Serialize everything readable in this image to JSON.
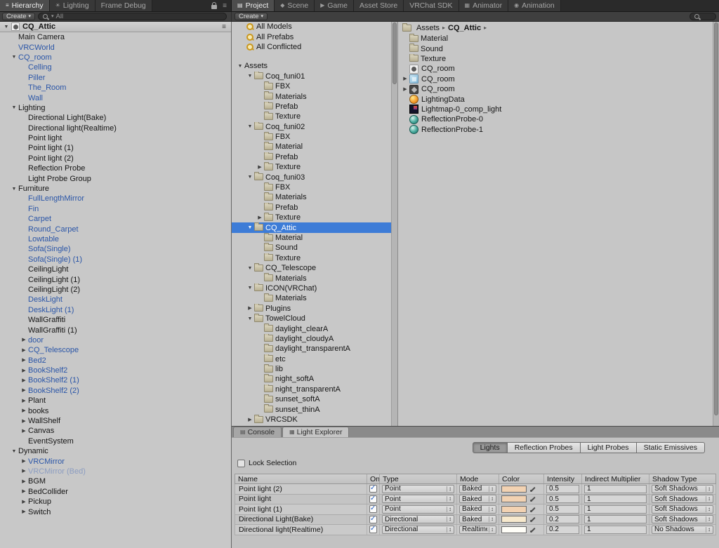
{
  "colors": {
    "selection_blue": "#3d7cd7",
    "prefab_text": "#2a55a7",
    "prefab_disabled_text": "#8b9cc0",
    "swatch_point": "#f2d2b2",
    "swatch_directional_baked": "#f7e9cd",
    "swatch_directional_realtime": "#fffef8"
  },
  "icons": {
    "expand_down": "▼",
    "expand_right": "▶",
    "dropdown_arrows": "↕",
    "breadcrumb_separator": "▸",
    "menu": "≡",
    "create_dropdown": "▾",
    "checkmark": "✓",
    "tab_glyphs": {
      "hierarchy": "≡",
      "lighting": "☀",
      "project": "▤",
      "scene": "◆",
      "game": "▶",
      "animator": "▦",
      "animation": "◉",
      "console": "▤",
      "light-explorer": "▦"
    }
  },
  "top_tabs": {
    "left": [
      {
        "label": "Hierarchy",
        "icon": "hierarchy",
        "active": true
      },
      {
        "label": "Lighting",
        "icon": "lighting",
        "active": false
      },
      {
        "label": "Frame Debug",
        "icon": "",
        "active": false
      }
    ],
    "right": [
      {
        "label": "Project",
        "icon": "project",
        "active": true
      },
      {
        "label": "Scene",
        "icon": "scene",
        "active": false
      },
      {
        "label": "Game",
        "icon": "game",
        "active": false
      },
      {
        "label": "Asset Store",
        "icon": "",
        "active": false
      },
      {
        "label": "VRChat SDK",
        "icon": "",
        "active": false
      },
      {
        "label": "Animator",
        "icon": "animator",
        "active": false
      },
      {
        "label": "Animation",
        "icon": "animation",
        "active": false
      }
    ]
  },
  "toolbars": {
    "hierarchy": {
      "create_label": "Create",
      "search_filter": "All"
    },
    "project": {
      "create_label": "Create"
    }
  },
  "hierarchy": {
    "scene_name": "CQ_Attic",
    "items": [
      {
        "label": "Main Camera",
        "indent": 1,
        "arrow": "",
        "style": "normal"
      },
      {
        "label": "VRCWorld",
        "indent": 1,
        "arrow": "",
        "style": "prefab"
      },
      {
        "label": "CQ_room",
        "indent": 1,
        "arrow": "down",
        "style": "prefab"
      },
      {
        "label": "Celling",
        "indent": 2,
        "arrow": "",
        "style": "prefab"
      },
      {
        "label": "Piller",
        "indent": 2,
        "arrow": "",
        "style": "prefab"
      },
      {
        "label": "The_Room",
        "indent": 2,
        "arrow": "",
        "style": "prefab"
      },
      {
        "label": "Wall",
        "indent": 2,
        "arrow": "",
        "style": "prefab"
      },
      {
        "label": "Lighting",
        "indent": 1,
        "arrow": "down",
        "style": "normal"
      },
      {
        "label": "Directional Light(Bake)",
        "indent": 2,
        "arrow": "",
        "style": "normal"
      },
      {
        "label": "Directional light(Realtime)",
        "indent": 2,
        "arrow": "",
        "style": "normal"
      },
      {
        "label": "Point light",
        "indent": 2,
        "arrow": "",
        "style": "normal"
      },
      {
        "label": "Point light (1)",
        "indent": 2,
        "arrow": "",
        "style": "normal"
      },
      {
        "label": "Point light (2)",
        "indent": 2,
        "arrow": "",
        "style": "normal"
      },
      {
        "label": "Reflection Probe",
        "indent": 2,
        "arrow": "",
        "style": "normal"
      },
      {
        "label": "Light Probe Group",
        "indent": 2,
        "arrow": "",
        "style": "normal"
      },
      {
        "label": "Furniture",
        "indent": 1,
        "arrow": "down",
        "style": "normal"
      },
      {
        "label": "FullLengthMirror",
        "indent": 2,
        "arrow": "",
        "style": "prefab"
      },
      {
        "label": "Fin",
        "indent": 2,
        "arrow": "",
        "style": "prefab"
      },
      {
        "label": "Carpet",
        "indent": 2,
        "arrow": "",
        "style": "prefab"
      },
      {
        "label": "Round_Carpet",
        "indent": 2,
        "arrow": "",
        "style": "prefab"
      },
      {
        "label": "Lowtable",
        "indent": 2,
        "arrow": "",
        "style": "prefab"
      },
      {
        "label": "Sofa(Single)",
        "indent": 2,
        "arrow": "",
        "style": "prefab"
      },
      {
        "label": "Sofa(Single) (1)",
        "indent": 2,
        "arrow": "",
        "style": "prefab"
      },
      {
        "label": "CeilingLight",
        "indent": 2,
        "arrow": "",
        "style": "normal"
      },
      {
        "label": "CeilingLight (1)",
        "indent": 2,
        "arrow": "",
        "style": "normal"
      },
      {
        "label": "CeilingLight (2)",
        "indent": 2,
        "arrow": "",
        "style": "normal"
      },
      {
        "label": "DeskLight",
        "indent": 2,
        "arrow": "",
        "style": "prefab"
      },
      {
        "label": "DeskLight (1)",
        "indent": 2,
        "arrow": "",
        "style": "prefab"
      },
      {
        "label": "WallGraffiti",
        "indent": 2,
        "arrow": "",
        "style": "normal"
      },
      {
        "label": "WallGraffiti (1)",
        "indent": 2,
        "arrow": "",
        "style": "normal"
      },
      {
        "label": "door",
        "indent": 2,
        "arrow": "right",
        "style": "prefab"
      },
      {
        "label": "CQ_Telescope",
        "indent": 2,
        "arrow": "right",
        "style": "prefab"
      },
      {
        "label": "Bed2",
        "indent": 2,
        "arrow": "right",
        "style": "prefab"
      },
      {
        "label": "BookShelf2",
        "indent": 2,
        "arrow": "right",
        "style": "prefab"
      },
      {
        "label": "BookShelf2 (1)",
        "indent": 2,
        "arrow": "right",
        "style": "prefab"
      },
      {
        "label": "BookShelf2 (2)",
        "indent": 2,
        "arrow": "right",
        "style": "prefab"
      },
      {
        "label": "Plant",
        "indent": 2,
        "arrow": "right",
        "style": "normal"
      },
      {
        "label": "books",
        "indent": 2,
        "arrow": "right",
        "style": "normal"
      },
      {
        "label": "WallShelf",
        "indent": 2,
        "arrow": "right",
        "style": "normal"
      },
      {
        "label": "Canvas",
        "indent": 2,
        "arrow": "right",
        "style": "normal"
      },
      {
        "label": "EventSystem",
        "indent": 2,
        "arrow": "",
        "style": "normal"
      },
      {
        "label": "Dynamic",
        "indent": 1,
        "arrow": "down",
        "style": "normal"
      },
      {
        "label": "VRCMirror",
        "indent": 2,
        "arrow": "right",
        "style": "prefab"
      },
      {
        "label": "VRCMirror (Bed)",
        "indent": 2,
        "arrow": "right",
        "style": "prefab-disabled"
      },
      {
        "label": "BGM",
        "indent": 2,
        "arrow": "right",
        "style": "normal"
      },
      {
        "label": "BedCollider",
        "indent": 2,
        "arrow": "right",
        "style": "normal"
      },
      {
        "label": "Pickup",
        "indent": 2,
        "arrow": "right",
        "style": "normal"
      },
      {
        "label": "Switch",
        "indent": 2,
        "arrow": "right",
        "style": "normal"
      }
    ]
  },
  "project_tree": {
    "favorites": [
      {
        "label": "All Models"
      },
      {
        "label": "All Prefabs"
      },
      {
        "label": "All Conflicted"
      }
    ],
    "items": [
      {
        "label": "Assets",
        "indent": 0,
        "arrow": "down",
        "icon": "",
        "selected": false
      },
      {
        "label": "Coq_funi01",
        "indent": 1,
        "arrow": "down",
        "icon": "folder",
        "selected": false
      },
      {
        "label": "FBX",
        "indent": 2,
        "arrow": "",
        "icon": "folder",
        "selected": false
      },
      {
        "label": "Materials",
        "indent": 2,
        "arrow": "",
        "icon": "folder",
        "selected": false
      },
      {
        "label": "Prefab",
        "indent": 2,
        "arrow": "",
        "icon": "folder",
        "selected": false
      },
      {
        "label": "Texture",
        "indent": 2,
        "arrow": "",
        "icon": "folder",
        "selected": false
      },
      {
        "label": "Coq_funi02",
        "indent": 1,
        "arrow": "down",
        "icon": "folder",
        "selected": false
      },
      {
        "label": "FBX",
        "indent": 2,
        "arrow": "",
        "icon": "folder",
        "selected": false
      },
      {
        "label": "Material",
        "indent": 2,
        "arrow": "",
        "icon": "folder",
        "selected": false
      },
      {
        "label": "Prefab",
        "indent": 2,
        "arrow": "",
        "icon": "folder",
        "selected": false
      },
      {
        "label": "Texture",
        "indent": 2,
        "arrow": "right",
        "icon": "folder",
        "selected": false
      },
      {
        "label": "Coq_funi03",
        "indent": 1,
        "arrow": "down",
        "icon": "folder",
        "selected": false
      },
      {
        "label": "FBX",
        "indent": 2,
        "arrow": "",
        "icon": "folder",
        "selected": false
      },
      {
        "label": "Materials",
        "indent": 2,
        "arrow": "",
        "icon": "folder",
        "selected": false
      },
      {
        "label": "Prefab",
        "indent": 2,
        "arrow": "",
        "icon": "folder",
        "selected": false
      },
      {
        "label": "Texture",
        "indent": 2,
        "arrow": "right",
        "icon": "folder",
        "selected": false
      },
      {
        "label": "CQ_Attic",
        "indent": 1,
        "arrow": "down",
        "icon": "folder",
        "selected": true
      },
      {
        "label": "Material",
        "indent": 2,
        "arrow": "",
        "icon": "folder",
        "selected": false
      },
      {
        "label": "Sound",
        "indent": 2,
        "arrow": "",
        "icon": "folder",
        "selected": false
      },
      {
        "label": "Texture",
        "indent": 2,
        "arrow": "",
        "icon": "folder",
        "selected": false
      },
      {
        "label": "CQ_Telescope",
        "indent": 1,
        "arrow": "down",
        "icon": "folder",
        "selected": false
      },
      {
        "label": "Materials",
        "indent": 2,
        "arrow": "",
        "icon": "folder",
        "selected": false
      },
      {
        "label": "ICON(VRChat)",
        "indent": 1,
        "arrow": "down",
        "icon": "folder",
        "selected": false
      },
      {
        "label": "Materials",
        "indent": 2,
        "arrow": "",
        "icon": "folder",
        "selected": false
      },
      {
        "label": "Plugins",
        "indent": 1,
        "arrow": "right",
        "icon": "folder",
        "selected": false
      },
      {
        "label": "TowelCloud",
        "indent": 1,
        "arrow": "down",
        "icon": "folder",
        "selected": false
      },
      {
        "label": "daylight_clearA",
        "indent": 2,
        "arrow": "",
        "icon": "folder",
        "selected": false
      },
      {
        "label": "daylight_cloudyA",
        "indent": 2,
        "arrow": "",
        "icon": "folder",
        "selected": false
      },
      {
        "label": "daylight_transparentA",
        "indent": 2,
        "arrow": "",
        "icon": "folder",
        "selected": false
      },
      {
        "label": "etc",
        "indent": 2,
        "arrow": "",
        "icon": "folder",
        "selected": false
      },
      {
        "label": "lib",
        "indent": 2,
        "arrow": "",
        "icon": "folder",
        "selected": false
      },
      {
        "label": "night_softA",
        "indent": 2,
        "arrow": "",
        "icon": "folder",
        "selected": false
      },
      {
        "label": "night_transparentA",
        "indent": 2,
        "arrow": "",
        "icon": "folder",
        "selected": false
      },
      {
        "label": "sunset_softA",
        "indent": 2,
        "arrow": "",
        "icon": "folder",
        "selected": false
      },
      {
        "label": "sunset_thinA",
        "indent": 2,
        "arrow": "",
        "icon": "folder",
        "selected": false
      },
      {
        "label": "VRCSDK",
        "indent": 1,
        "arrow": "right",
        "icon": "folder",
        "selected": false
      }
    ]
  },
  "project_contents": {
    "breadcrumb": {
      "root": "Assets",
      "current": "CQ_Attic"
    },
    "items": [
      {
        "label": "Material",
        "icon": "folder",
        "arrow": ""
      },
      {
        "label": "Sound",
        "icon": "folder",
        "arrow": ""
      },
      {
        "label": "Texture",
        "icon": "folder",
        "arrow": ""
      },
      {
        "label": "CQ_room",
        "icon": "scene",
        "arrow": ""
      },
      {
        "label": "CQ_room",
        "icon": "model",
        "arrow": "right"
      },
      {
        "label": "CQ_room",
        "icon": "unity-asset",
        "arrow": "right"
      },
      {
        "label": "LightingData",
        "icon": "lighting-data",
        "arrow": ""
      },
      {
        "label": "Lightmap-0_comp_light",
        "icon": "lightmap",
        "arrow": ""
      },
      {
        "label": "ReflectionProbe-0",
        "icon": "reflection-probe",
        "arrow": ""
      },
      {
        "label": "ReflectionProbe-1",
        "icon": "reflection-probe",
        "arrow": ""
      }
    ]
  },
  "light_explorer": {
    "tabs": [
      {
        "label": "Console",
        "icon": "console",
        "active": false
      },
      {
        "label": "Light Explorer",
        "icon": "light-explorer",
        "active": true
      }
    ],
    "filter_buttons": [
      {
        "label": "Lights",
        "active": true
      },
      {
        "label": "Reflection Probes",
        "active": false
      },
      {
        "label": "Light Probes",
        "active": false
      },
      {
        "label": "Static Emissives",
        "active": false
      }
    ],
    "lock_selection_label": "Lock Selection",
    "table": {
      "columns": [
        "Name",
        "On",
        "Type",
        "Mode",
        "Color",
        "Intensity",
        "Indirect Multiplier",
        "Shadow Type"
      ],
      "rows": [
        {
          "name": "Point light (2)",
          "on": true,
          "type": "Point",
          "mode": "Baked",
          "color": "#f2d2b2",
          "intensity": "0.5",
          "indirect_multiplier": "1",
          "shadow_type": "Soft Shadows"
        },
        {
          "name": "Point light",
          "on": true,
          "type": "Point",
          "mode": "Baked",
          "color": "#f2d2b2",
          "intensity": "0.5",
          "indirect_multiplier": "1",
          "shadow_type": "Soft Shadows"
        },
        {
          "name": "Point light (1)",
          "on": true,
          "type": "Point",
          "mode": "Baked",
          "color": "#f2d2b2",
          "intensity": "0.5",
          "indirect_multiplier": "1",
          "shadow_type": "Soft Shadows"
        },
        {
          "name": "Directional Light(Bake)",
          "on": true,
          "type": "Directional",
          "mode": "Baked",
          "color": "#f7e9cd",
          "intensity": "0.2",
          "indirect_multiplier": "1",
          "shadow_type": "Soft Shadows"
        },
        {
          "name": "Directional light(Realtime)",
          "on": true,
          "type": "Directional",
          "mode": "Realtime",
          "color": "#fffef8",
          "intensity": "0.2",
          "indirect_multiplier": "1",
          "shadow_type": "No Shadows"
        }
      ]
    }
  }
}
